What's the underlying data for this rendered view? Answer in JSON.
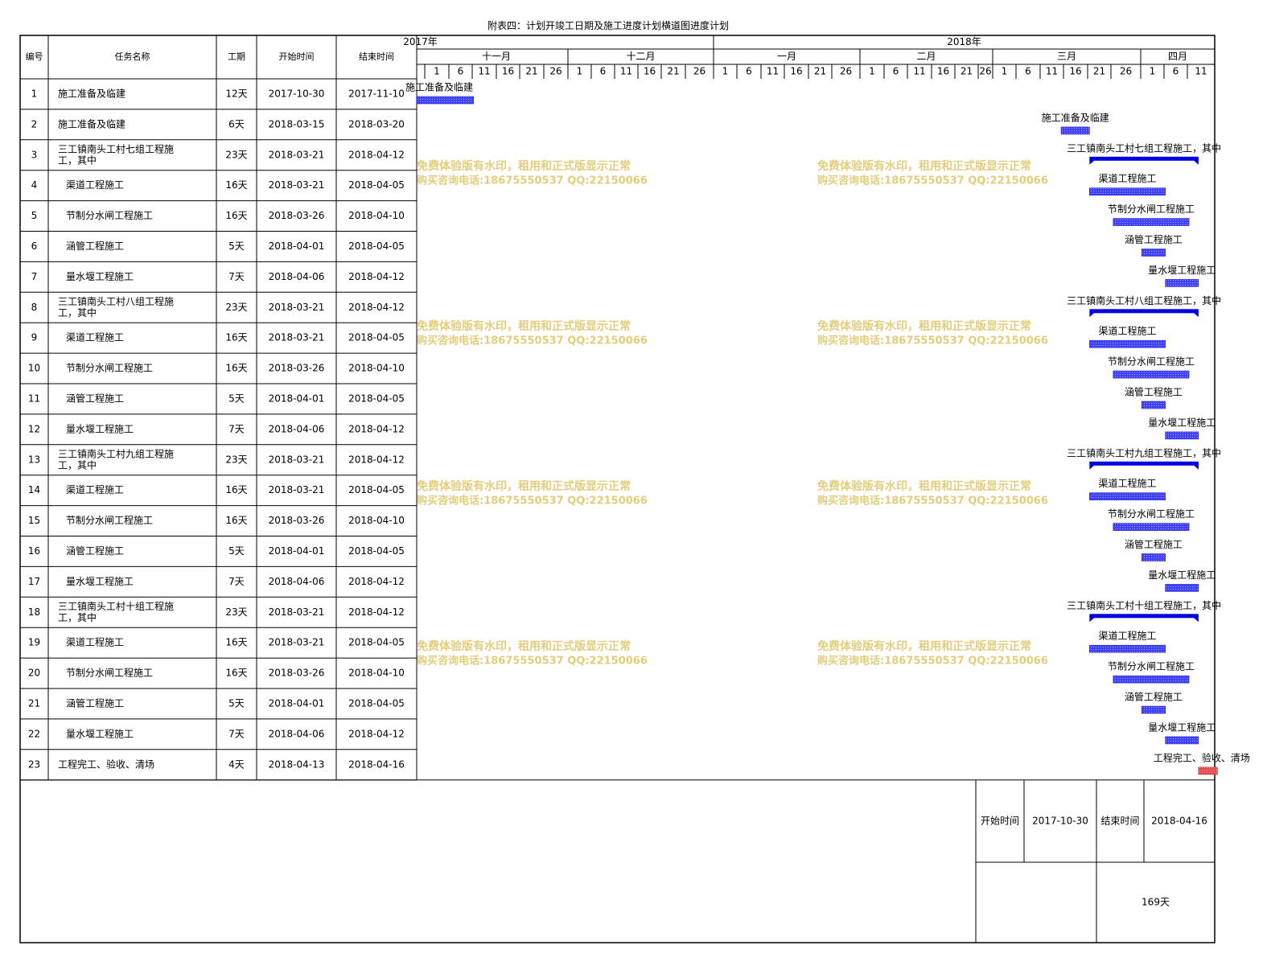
{
  "title": "附表四：计划开竣工日期及施工进度计划横道图进度计划",
  "colors": {
    "bar": "#4040ff",
    "summary": "#0000e0",
    "final": "#e05050",
    "grid": "#000000",
    "watermark": "#e3cd7c"
  },
  "table_headers": {
    "id": "编号",
    "name": "任务名称",
    "duration": "工期",
    "start": "开始时间",
    "end": "结束时间"
  },
  "timeline": {
    "years": [
      "2017年",
      "2018年"
    ],
    "months": [
      "十一月",
      "十二月",
      "一月",
      "二月",
      "三月",
      "四月"
    ],
    "day_ticks": [
      [
        "1",
        "6",
        "11",
        "16",
        "21",
        "26"
      ],
      [
        "1",
        "6",
        "11",
        "16",
        "21",
        "26"
      ],
      [
        "1",
        "6",
        "11",
        "16",
        "21",
        "26"
      ],
      [
        "1",
        "6",
        "11",
        "16",
        "21",
        "26"
      ],
      [
        "1",
        "6",
        "11",
        "16",
        "21",
        "26"
      ],
      [
        "1",
        "6",
        "11"
      ]
    ]
  },
  "chart_data": {
    "type": "gantt",
    "axis_start": "2017-10-30",
    "axis_end": "2018-04-16",
    "tasks": [
      {
        "id": "1",
        "name": "施工准备及临建",
        "duration": "12天",
        "start": "2017-10-30",
        "end": "2017-11-10",
        "kind": "task"
      },
      {
        "id": "2",
        "name": "施工准备及临建",
        "duration": "6天",
        "start": "2018-03-15",
        "end": "2018-03-20",
        "kind": "task"
      },
      {
        "id": "3",
        "name": "三工镇南头工村七组工程施工，其中",
        "duration": "23天",
        "start": "2018-03-21",
        "end": "2018-04-12",
        "kind": "summary"
      },
      {
        "id": "4",
        "name": "渠道工程施工",
        "duration": "16天",
        "start": "2018-03-21",
        "end": "2018-04-05",
        "kind": "task"
      },
      {
        "id": "5",
        "name": "节制分水闸工程施工",
        "duration": "16天",
        "start": "2018-03-26",
        "end": "2018-04-10",
        "kind": "task"
      },
      {
        "id": "6",
        "name": "涵管工程施工",
        "duration": "5天",
        "start": "2018-04-01",
        "end": "2018-04-05",
        "kind": "task"
      },
      {
        "id": "7",
        "name": "量水堰工程施工",
        "duration": "7天",
        "start": "2018-04-06",
        "end": "2018-04-12",
        "kind": "task"
      },
      {
        "id": "8",
        "name": "三工镇南头工村八组工程施工，其中",
        "duration": "23天",
        "start": "2018-03-21",
        "end": "2018-04-12",
        "kind": "summary"
      },
      {
        "id": "9",
        "name": "渠道工程施工",
        "duration": "16天",
        "start": "2018-03-21",
        "end": "2018-04-05",
        "kind": "task"
      },
      {
        "id": "10",
        "name": "节制分水闸工程施工",
        "duration": "16天",
        "start": "2018-03-26",
        "end": "2018-04-10",
        "kind": "task"
      },
      {
        "id": "11",
        "name": "涵管工程施工",
        "duration": "5天",
        "start": "2018-04-01",
        "end": "2018-04-05",
        "kind": "task"
      },
      {
        "id": "12",
        "name": "量水堰工程施工",
        "duration": "7天",
        "start": "2018-04-06",
        "end": "2018-04-12",
        "kind": "task"
      },
      {
        "id": "13",
        "name": "三工镇南头工村九组工程施工，其中",
        "duration": "23天",
        "start": "2018-03-21",
        "end": "2018-04-12",
        "kind": "summary"
      },
      {
        "id": "14",
        "name": "渠道工程施工",
        "duration": "16天",
        "start": "2018-03-21",
        "end": "2018-04-05",
        "kind": "task"
      },
      {
        "id": "15",
        "name": "节制分水闸工程施工",
        "duration": "16天",
        "start": "2018-03-26",
        "end": "2018-04-10",
        "kind": "task"
      },
      {
        "id": "16",
        "name": "涵管工程施工",
        "duration": "5天",
        "start": "2018-04-01",
        "end": "2018-04-05",
        "kind": "task"
      },
      {
        "id": "17",
        "name": "量水堰工程施工",
        "duration": "7天",
        "start": "2018-04-06",
        "end": "2018-04-12",
        "kind": "task"
      },
      {
        "id": "18",
        "name": "三工镇南头工村十组工程施工，其中",
        "duration": "23天",
        "start": "2018-03-21",
        "end": "2018-04-12",
        "kind": "summary"
      },
      {
        "id": "19",
        "name": "渠道工程施工",
        "duration": "16天",
        "start": "2018-03-21",
        "end": "2018-04-05",
        "kind": "task"
      },
      {
        "id": "20",
        "name": "节制分水闸工程施工",
        "duration": "16天",
        "start": "2018-03-26",
        "end": "2018-04-10",
        "kind": "task"
      },
      {
        "id": "21",
        "name": "涵管工程施工",
        "duration": "5天",
        "start": "2018-04-01",
        "end": "2018-04-05",
        "kind": "task"
      },
      {
        "id": "22",
        "name": "量水堰工程施工",
        "duration": "7天",
        "start": "2018-04-06",
        "end": "2018-04-12",
        "kind": "task"
      },
      {
        "id": "23",
        "name": "工程完工、验收、清场",
        "duration": "4天",
        "start": "2018-04-13",
        "end": "2018-04-16",
        "kind": "final"
      }
    ]
  },
  "summary": {
    "start_label": "开始时间",
    "start_value": "2017-10-30",
    "end_label": "结束时间",
    "end_value": "2018-04-16",
    "total": "169天"
  },
  "watermark": {
    "line1": "免费体验版有水印，租用和正式版显示正常",
    "line2": "购买咨询电话:18675550537 QQ:22150066"
  }
}
